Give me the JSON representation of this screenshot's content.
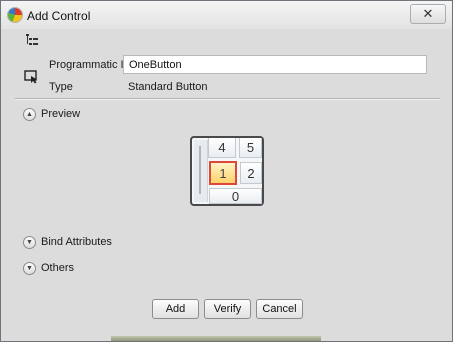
{
  "window": {
    "title": "Add Control",
    "close_glyph": "✕"
  },
  "icons": {
    "app": "app-logo-icon",
    "properties": "properties-list-icon",
    "control": "control-cursor-icon"
  },
  "fields": {
    "programmatic_id": {
      "label": "Programmatic Id",
      "value": "OneButton"
    },
    "type": {
      "label": "Type",
      "value": "Standard Button"
    }
  },
  "sections": {
    "preview": {
      "label": "Preview",
      "expanded": true
    },
    "bind_attributes": {
      "label": "Bind Attributes",
      "expanded": false
    },
    "others": {
      "label": "Others",
      "expanded": false
    }
  },
  "preview_keys": [
    "4",
    "5",
    "1",
    "2",
    "0"
  ],
  "preview_selected_key": "1",
  "buttons": {
    "add": "Add",
    "verify": "Verify",
    "cancel": "Cancel"
  },
  "colors": {
    "accent": "#e0473a",
    "selected_fill": "#ffd36b"
  }
}
